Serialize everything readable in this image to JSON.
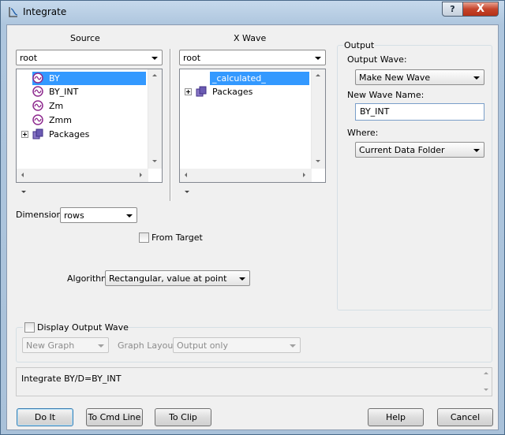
{
  "window": {
    "title": "Integrate",
    "help_label": "?",
    "close_label": "X"
  },
  "source": {
    "header": "Source",
    "folder": "root",
    "items": [
      {
        "label": "BY",
        "type": "wave",
        "selected": true
      },
      {
        "label": "BY_INT",
        "type": "wave",
        "selected": false
      },
      {
        "label": "Zm",
        "type": "wave",
        "selected": false
      },
      {
        "label": "Zmm",
        "type": "wave",
        "selected": false
      },
      {
        "label": "Packages",
        "type": "folder",
        "selected": false
      }
    ]
  },
  "xwave": {
    "header": "X Wave",
    "folder": "root",
    "items": [
      {
        "label": "_calculated_",
        "type": "special",
        "selected": true
      },
      {
        "label": "Packages",
        "type": "folder",
        "selected": false
      }
    ]
  },
  "dimension": {
    "label": "Dimension:",
    "value": "rows"
  },
  "from_target": {
    "label": "From Target",
    "checked": false
  },
  "algorithm": {
    "label": "Algorithm:",
    "value": "Rectangular, value at point"
  },
  "output": {
    "group_label": "Output",
    "wave_label": "Output Wave:",
    "wave_value": "Make New Wave",
    "name_label": "New Wave Name:",
    "name_value": "BY_INT",
    "where_label": "Where:",
    "where_value": "Current Data Folder"
  },
  "display": {
    "label": "Display Output Wave",
    "checked": false,
    "graph_value": "New Graph",
    "layout_label": "Graph Layout:",
    "layout_value": "Output only"
  },
  "command": "Integrate BY/D=BY_INT",
  "buttons": {
    "doit": "Do It",
    "cmdline": "To Cmd Line",
    "clip": "To Clip",
    "help": "Help",
    "cancel": "Cancel"
  },
  "colors": {
    "selection": "#3399ff",
    "close_button": "#c5442b",
    "wave_icon": "#8e2a8e"
  }
}
